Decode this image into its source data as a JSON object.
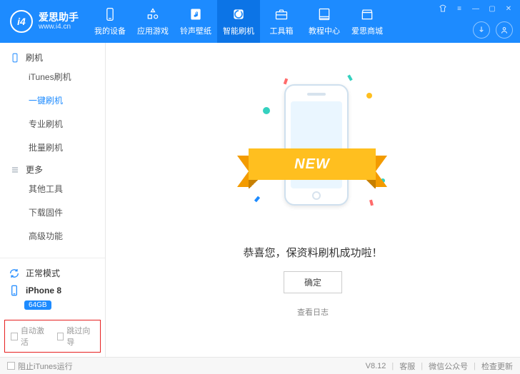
{
  "brand": {
    "logo_text": "i4",
    "title": "爱思助手",
    "url": "www.i4.cn"
  },
  "top_nav": [
    {
      "label": "我的设备",
      "icon": "phone"
    },
    {
      "label": "应用游戏",
      "icon": "apps"
    },
    {
      "label": "铃声壁纸",
      "icon": "music"
    },
    {
      "label": "智能刷机",
      "icon": "flash",
      "active": true
    },
    {
      "label": "工具箱",
      "icon": "toolbox"
    },
    {
      "label": "教程中心",
      "icon": "book"
    },
    {
      "label": "爱思商城",
      "icon": "store"
    }
  ],
  "sidebar": {
    "groups": [
      {
        "icon": "phone-outline",
        "title": "刷机",
        "items": [
          {
            "label": "iTunes刷机"
          },
          {
            "label": "一键刷机",
            "active": true
          },
          {
            "label": "专业刷机"
          },
          {
            "label": "批量刷机"
          }
        ]
      },
      {
        "icon": "menu",
        "title": "更多",
        "items": [
          {
            "label": "其他工具"
          },
          {
            "label": "下载固件"
          },
          {
            "label": "高级功能"
          }
        ]
      }
    ],
    "mode_label": "正常模式",
    "device_name": "iPhone 8",
    "device_capacity": "64GB",
    "check_auto_activate": "自动激活",
    "check_skip_guide": "跳过向导"
  },
  "main": {
    "ribbon_text": "NEW",
    "success_msg": "恭喜您，保资料刷机成功啦！",
    "ok_label": "确定",
    "log_link": "查看日志"
  },
  "footer": {
    "block_itunes": "阻止iTunes运行",
    "version": "V8.12",
    "support": "客服",
    "wechat": "微信公众号",
    "update": "检查更新"
  }
}
